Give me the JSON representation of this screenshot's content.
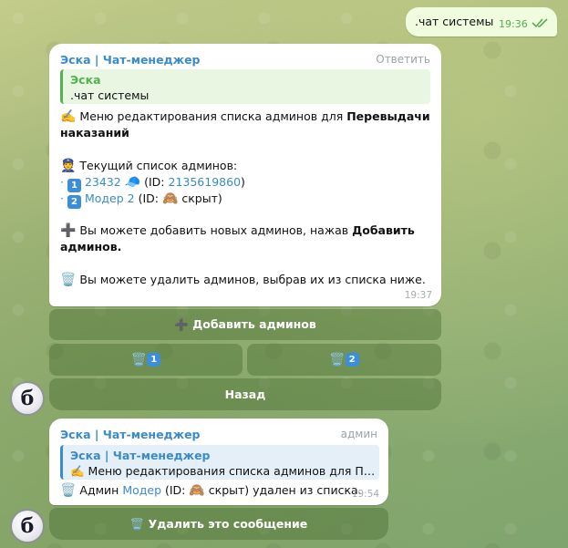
{
  "outgoing": {
    "text": ".чат системы",
    "time": "19:36"
  },
  "message1": {
    "sender": "Эска | Чат-менеджер",
    "reply_action": "Ответить",
    "quote": {
      "title": "Эска",
      "text": ".чат системы"
    },
    "title_icon": "✍️",
    "title_prefix": " Меню редактирования списка админов для ",
    "title_bold": "Перевыдачи",
    "title_bold2": "наказаний",
    "list_icon": "👮",
    "list_header": " Текущий список админов:",
    "admins": [
      {
        "bullet": "·",
        "num": "1",
        "name": "23432",
        "emoji": "🧢",
        "id_prefix": " (ID: ",
        "id": "2135619860",
        "id_suffix": ")"
      },
      {
        "bullet": "·",
        "num": "2",
        "name": "Модер 2",
        "emoji": "🙈",
        "id_prefix": " (ID: ",
        "id": " скрыт",
        "id_suffix": ")"
      }
    ],
    "add_icon": "➕",
    "add_prefix": " Вы можете добавить новых админов, нажав ",
    "add_bold": "Добавить",
    "add_bold2": "админов.",
    "remove_icon": "🗑️",
    "remove_text": " Вы можете удалить админов, выбрав их из списка ниже.",
    "time": "19:37"
  },
  "keyboard1": {
    "add_button": "➕ Добавить админов",
    "remove1_icon": "🗑️",
    "remove1_num": "1",
    "remove2_icon": "🗑️",
    "remove2_num": "2",
    "back_button": "Назад"
  },
  "message2": {
    "sender": "Эска | Чат-менеджер",
    "role": "админ",
    "quote": {
      "title": "Эска | Чат-менеджер",
      "text": "✍️ Меню редактирования списка админов для Перевыдачи наказаний"
    },
    "icon": "🗑️",
    "text_prefix": " Админ ",
    "admin_name": "Модер",
    "text_mid": " (ID: ",
    "emoji": "🙈",
    "text_suffix": " скрыт) удален из списка.",
    "time": "19:54"
  },
  "keyboard2": {
    "delete_button": "🗑️ Удалить это сообщение"
  },
  "bot_avatar_letter": "б"
}
